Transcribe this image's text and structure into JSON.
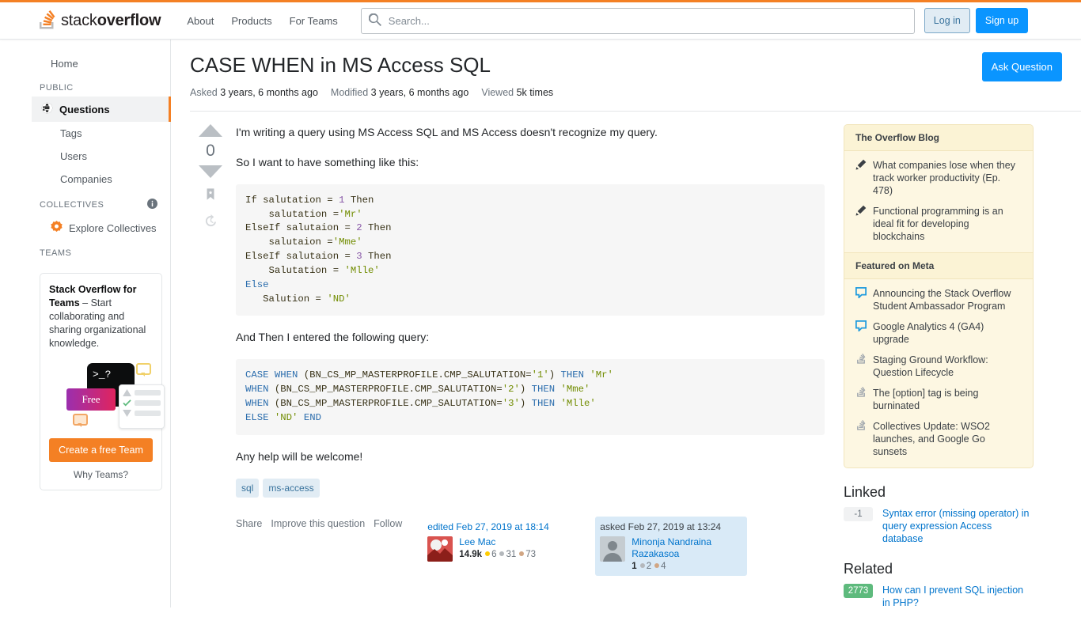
{
  "header": {
    "logo_text_light": "stack",
    "logo_text_bold": "overflow",
    "nav": [
      {
        "label": "About"
      },
      {
        "label": "Products"
      },
      {
        "label": "For Teams"
      }
    ],
    "search": {
      "placeholder": "Search...",
      "value": ""
    },
    "login_label": "Log in",
    "signup_label": "Sign up"
  },
  "sidebar": {
    "home_label": "Home",
    "public_heading": "PUBLIC",
    "public_items": [
      {
        "label": "Questions",
        "active": true
      },
      {
        "label": "Tags",
        "active": false
      },
      {
        "label": "Users",
        "active": false
      },
      {
        "label": "Companies",
        "active": false
      }
    ],
    "collectives_heading": "COLLECTIVES",
    "explore_collectives_label": "Explore Collectives",
    "teams_heading": "TEAMS",
    "teams_promo": {
      "title_bold": "Stack Overflow for Teams",
      "title_rest": " – Start collaborating and sharing organizational knowledge.",
      "art_terminal": ">_?",
      "art_free_label": "Free",
      "cta_label": "Create a free Team",
      "why_label": "Why Teams?"
    }
  },
  "question": {
    "title": "CASE WHEN in MS Access SQL",
    "asked_label": "Asked",
    "asked_value": "3 years, 6 months ago",
    "modified_label": "Modified",
    "modified_value": "3 years, 6 months ago",
    "viewed_label": "Viewed",
    "viewed_value": "5k times",
    "ask_question_label": "Ask Question",
    "vote_count": "0",
    "paragraph_1": "I'm writing a query using MS Access SQL and MS Access doesn't recognize my query.",
    "paragraph_2": "So I want to have something like this:",
    "code_1": [
      {
        "parts": [
          {
            "t": "If salutation = ",
            "c": ""
          },
          {
            "t": "1",
            "c": "num"
          },
          {
            "t": " Then",
            "c": ""
          }
        ]
      },
      {
        "parts": [
          {
            "t": "    salutation =",
            "c": ""
          },
          {
            "t": "'Mr'",
            "c": "str"
          }
        ]
      },
      {
        "parts": [
          {
            "t": "ElseIf salutaion = ",
            "c": ""
          },
          {
            "t": "2",
            "c": "num"
          },
          {
            "t": " Then",
            "c": ""
          }
        ]
      },
      {
        "parts": [
          {
            "t": "    salutaion =",
            "c": ""
          },
          {
            "t": "'Mme'",
            "c": "str"
          }
        ]
      },
      {
        "parts": [
          {
            "t": "ElseIf salutaion = ",
            "c": ""
          },
          {
            "t": "3",
            "c": "num"
          },
          {
            "t": " Then",
            "c": ""
          }
        ]
      },
      {
        "parts": [
          {
            "t": "    Salutation = ",
            "c": ""
          },
          {
            "t": "'Mlle'",
            "c": "str"
          }
        ]
      },
      {
        "parts": [
          {
            "t": "Else",
            "c": "kw"
          }
        ]
      },
      {
        "parts": [
          {
            "t": "   Salution = ",
            "c": ""
          },
          {
            "t": "'ND'",
            "c": "str"
          }
        ]
      }
    ],
    "paragraph_3": "And Then I entered the following query:",
    "code_2": [
      {
        "parts": [
          {
            "t": "CASE WHEN ",
            "c": "kw"
          },
          {
            "t": "(BN_CS_MP_MASTERPROFILE.CMP_SALUTATION=",
            "c": ""
          },
          {
            "t": "'1'",
            "c": "str"
          },
          {
            "t": ") ",
            "c": ""
          },
          {
            "t": "THEN ",
            "c": "kw"
          },
          {
            "t": "'Mr'",
            "c": "str"
          }
        ]
      },
      {
        "parts": [
          {
            "t": "WHEN ",
            "c": "kw"
          },
          {
            "t": "(BN_CS_MP_MASTERPROFILE.CMP_SALUTATION=",
            "c": ""
          },
          {
            "t": "'2'",
            "c": "str"
          },
          {
            "t": ") ",
            "c": ""
          },
          {
            "t": "THEN ",
            "c": "kw"
          },
          {
            "t": "'Mme'",
            "c": "str"
          }
        ]
      },
      {
        "parts": [
          {
            "t": "WHEN ",
            "c": "kw"
          },
          {
            "t": "(BN_CS_MP_MASTERPROFILE.CMP_SALUTATION=",
            "c": ""
          },
          {
            "t": "'3'",
            "c": "str"
          },
          {
            "t": ") ",
            "c": ""
          },
          {
            "t": "THEN ",
            "c": "kw"
          },
          {
            "t": "'Mlle'",
            "c": "str"
          }
        ]
      },
      {
        "parts": [
          {
            "t": "ELSE ",
            "c": "kw"
          },
          {
            "t": "'ND'",
            "c": "str"
          },
          {
            "t": " ",
            "c": ""
          },
          {
            "t": "END",
            "c": "kw"
          }
        ]
      }
    ],
    "paragraph_4": "Any help will be welcome!",
    "tags": [
      {
        "label": "sql"
      },
      {
        "label": "ms-access"
      }
    ],
    "actions": [
      {
        "label": "Share"
      },
      {
        "label": "Improve this question"
      },
      {
        "label": "Follow"
      }
    ],
    "editor": {
      "time_label": "edited Feb 27, 2019 at 18:14",
      "name": "Lee Mac",
      "rep": "14.9k",
      "gold": "6",
      "silver": "31",
      "bronze": "73"
    },
    "asker": {
      "time_label": "asked Feb 27, 2019 at 13:24",
      "name": "Minonja Nandraina Razakasoa",
      "rep": "1",
      "silver": "2",
      "bronze": "4"
    }
  },
  "rail": {
    "blog_heading": "The Overflow Blog",
    "blog_items": [
      {
        "icon": "pencil-icon",
        "label": "What companies lose when they track worker productivity (Ep. 478)"
      },
      {
        "icon": "pencil-icon",
        "label": "Functional programming is an ideal fit for developing blockchains"
      }
    ],
    "meta_heading": "Featured on Meta",
    "meta_items": [
      {
        "icon": "speech-bubble-icon",
        "label": "Announcing the Stack Overflow Student Ambassador Program"
      },
      {
        "icon": "speech-bubble-icon",
        "label": "Google Analytics 4 (GA4) upgrade"
      },
      {
        "icon": "stackoverflow-icon",
        "label": "Staging Ground Workflow: Question Lifecycle"
      },
      {
        "icon": "stackoverflow-icon",
        "label": "The [option] tag is being burninated"
      },
      {
        "icon": "stackoverflow-icon",
        "label": "Collectives Update: WSO2 launches, and Google Go sunsets"
      }
    ],
    "linked_heading": "Linked",
    "linked_items": [
      {
        "score": "-1",
        "style": "sc-zero",
        "label": "Syntax error (missing operator) in query expression Access database"
      }
    ],
    "related_heading": "Related",
    "related_items": [
      {
        "score": "2773",
        "style": "sc-green",
        "label": "How can I prevent SQL injection in PHP?"
      }
    ]
  },
  "colors": {
    "accent_orange": "#f48024",
    "primary_blue": "#0a95ff",
    "link_blue": "#0074cc",
    "rail_bg": "#fdf7e2"
  }
}
